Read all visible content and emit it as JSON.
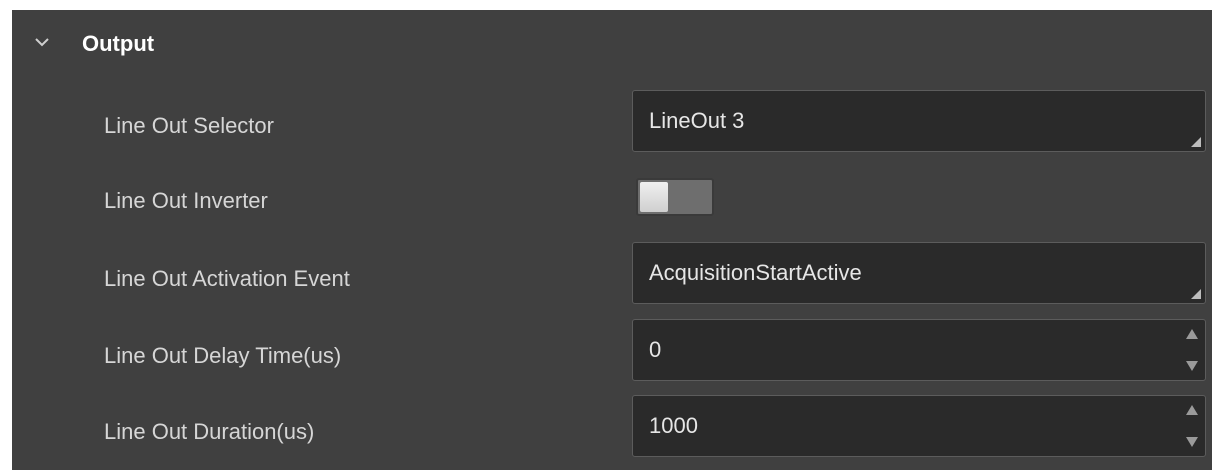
{
  "section": {
    "title": "Output",
    "expanded": true
  },
  "rows": {
    "line_out_selector": {
      "label": "Line Out Selector",
      "value": "LineOut 3"
    },
    "line_out_inverter": {
      "label": "Line Out Inverter",
      "enabled": false
    },
    "line_out_activation_event": {
      "label": "Line Out Activation Event",
      "value": "AcquisitionStartActive"
    },
    "line_out_delay_time": {
      "label": "Line Out Delay Time(us)",
      "value": "0"
    },
    "line_out_duration": {
      "label": "Line Out Duration(us)",
      "value": "1000"
    }
  },
  "icons": {
    "expand": "chevron-down-icon",
    "dropdown": "dropdown-corner-icon",
    "increment": "spin-up-icon",
    "decrement": "spin-down-icon"
  },
  "colors": {
    "panel_bg": "#404040",
    "field_bg": "#2a2a2a",
    "field_border": "#5c5c5c",
    "text": "#d6d6d6",
    "header_text": "#ffffff"
  }
}
